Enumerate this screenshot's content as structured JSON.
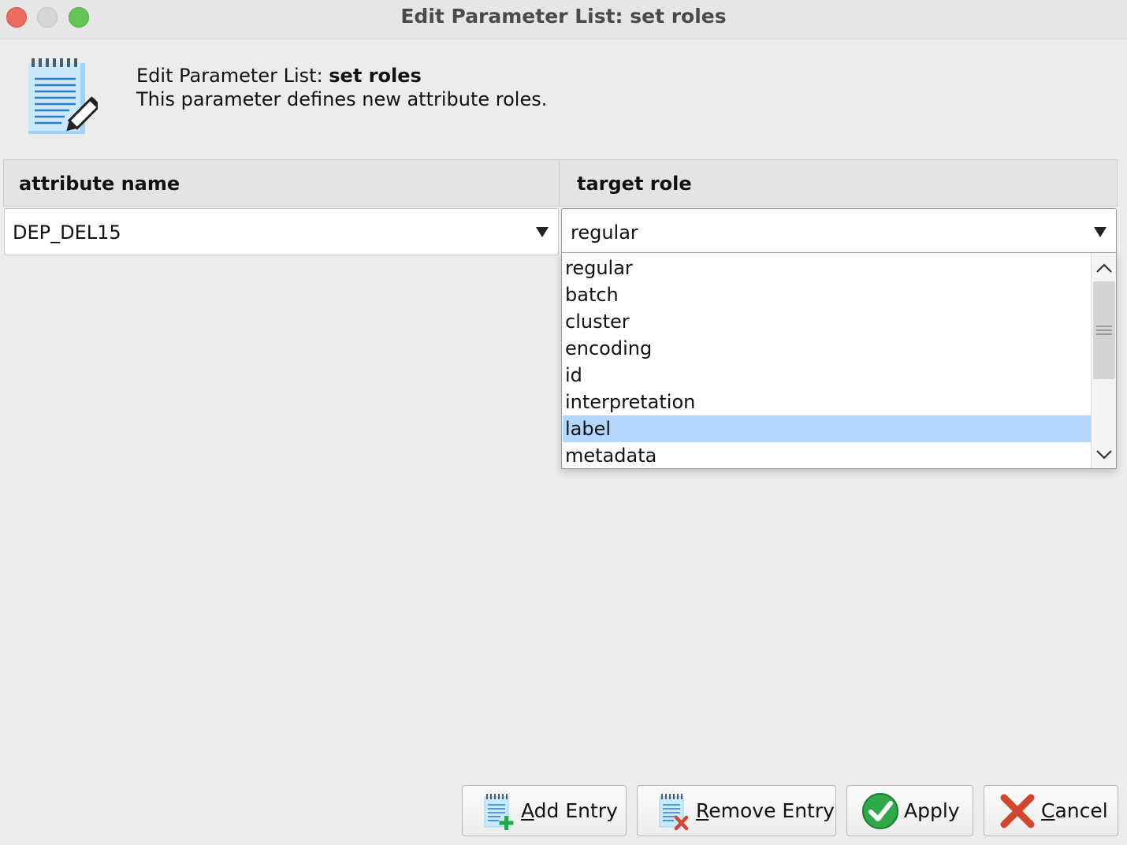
{
  "window": {
    "title": "Edit Parameter List: set roles"
  },
  "header": {
    "title_prefix": "Edit Parameter List: ",
    "title_bold": "set roles",
    "description": "This parameter defines new attribute roles."
  },
  "table": {
    "columns": [
      "attribute name",
      "target role"
    ],
    "row": {
      "attribute_name": "DEP_DEL15",
      "target_role": "regular"
    }
  },
  "dropdown": {
    "options": [
      "regular",
      "batch",
      "cluster",
      "encoding",
      "id",
      "interpretation",
      "label",
      "metadata"
    ],
    "highlighted": "label",
    "highlight_color": "#b3d6fd"
  },
  "buttons": {
    "add": {
      "mnemonic": "A",
      "rest": "dd Entry"
    },
    "remove": {
      "mnemonic": "R",
      "rest": "emove Entry"
    },
    "apply": {
      "label": "Apply"
    },
    "cancel": {
      "mnemonic": "C",
      "rest": "ancel"
    }
  },
  "icons": {
    "header": "notepad-pencil-icon",
    "add": "notepad-add-icon",
    "remove": "notepad-remove-icon",
    "apply": "check-icon",
    "cancel": "x-icon"
  }
}
